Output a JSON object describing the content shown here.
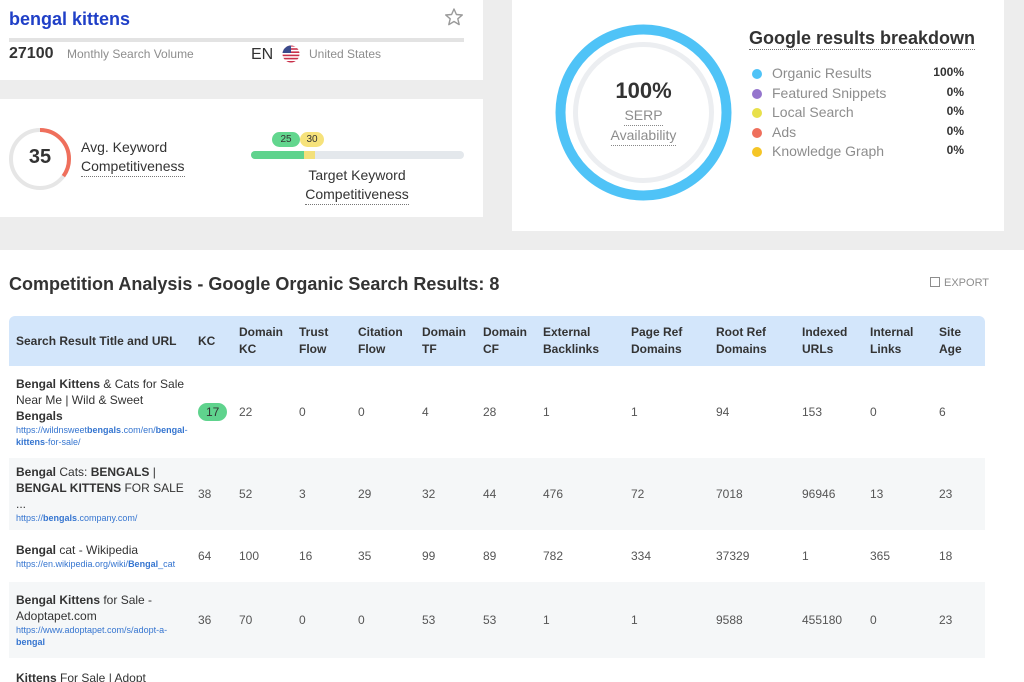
{
  "keyword": {
    "title": "bengal kittens",
    "volume": "27100",
    "volume_label": "Monthly Search Volume",
    "language": "EN",
    "country": "United States"
  },
  "competitiveness": {
    "avg_value": "35",
    "avg_fraction": 0.35,
    "avg_label_line1": "Avg. Keyword",
    "avg_label_line2": "Competitiveness",
    "target_low": "25",
    "target_high": "30",
    "target_low_fraction": 0.25,
    "target_high_fraction": 0.3,
    "target_label_line1": "Target Keyword",
    "target_label_line2": "Competitiveness"
  },
  "serp": {
    "percent": "100%",
    "label_line1": "SERP",
    "label_line2": "Availability",
    "breakdown_title": "Google results breakdown",
    "items": [
      {
        "name": "Organic Results",
        "value": "100%",
        "color": "#4fc3f7"
      },
      {
        "name": "Featured Snippets",
        "value": "0%",
        "color": "#9575cd"
      },
      {
        "name": "Local Search",
        "value": "0%",
        "color": "#e8e04a"
      },
      {
        "name": "Ads",
        "value": "0%",
        "color": "#ef6f5c"
      },
      {
        "name": "Knowledge Graph",
        "value": "0%",
        "color": "#f5c526"
      }
    ]
  },
  "analysis": {
    "title": "Competition Analysis - Google Organic Search Results: 8",
    "export_label": "EXPORT",
    "headers": [
      [
        "Search Result Title and URL"
      ],
      [
        "KC"
      ],
      [
        "Domain",
        "KC"
      ],
      [
        "Trust",
        "Flow"
      ],
      [
        "Citation",
        "Flow"
      ],
      [
        "Domain",
        "TF"
      ],
      [
        "Domain",
        "CF"
      ],
      [
        "External",
        "Backlinks"
      ],
      [
        "Page Ref",
        "Domains"
      ],
      [
        "Root Ref",
        "Domains"
      ],
      [
        "Indexed",
        "URLs"
      ],
      [
        "Internal",
        "Links"
      ],
      [
        "Site",
        "Age"
      ]
    ],
    "rows": [
      {
        "title_parts": [
          [
            "Bengal Kittens",
            true
          ],
          [
            " & Cats for Sale Near Me | Wild & Sweet ",
            false
          ],
          [
            "Bengals",
            true
          ]
        ],
        "url_parts": [
          [
            "https://wildnsweet",
            false
          ],
          [
            "bengals",
            true
          ],
          [
            ".com/en/",
            false
          ],
          [
            "bengal",
            true
          ],
          [
            "-",
            false
          ],
          [
            "kittens",
            true
          ],
          [
            "-for-sale/",
            false
          ]
        ],
        "kc": "17",
        "kc_highlight": true,
        "values": [
          "22",
          "0",
          "0",
          "4",
          "28",
          "1",
          "1",
          "94",
          "153",
          "0",
          "6"
        ]
      },
      {
        "title_parts": [
          [
            "Bengal",
            true
          ],
          [
            " Cats: ",
            false
          ],
          [
            "BENGALS",
            true
          ],
          [
            " | ",
            false
          ],
          [
            "BENGAL KITTENS",
            true
          ],
          [
            " FOR SALE ...",
            false
          ]
        ],
        "url_parts": [
          [
            "https://",
            false
          ],
          [
            "bengals",
            true
          ],
          [
            ".company.com/",
            false
          ]
        ],
        "kc": "38",
        "kc_highlight": false,
        "values": [
          "52",
          "3",
          "29",
          "32",
          "44",
          "476",
          "72",
          "7018",
          "96946",
          "13",
          "23"
        ]
      },
      {
        "title_parts": [
          [
            "Bengal",
            true
          ],
          [
            " cat - Wikipedia",
            false
          ]
        ],
        "url_parts": [
          [
            "https://en.wikipedia.org/wiki/",
            false
          ],
          [
            "Bengal",
            true
          ],
          [
            "_cat",
            false
          ]
        ],
        "kc": "64",
        "kc_highlight": false,
        "values": [
          "100",
          "16",
          "35",
          "99",
          "89",
          "782",
          "334",
          "37329",
          "1",
          "365",
          "18"
        ]
      },
      {
        "title_parts": [
          [
            "Bengal Kittens",
            true
          ],
          [
            " for Sale - Adoptapet.com",
            false
          ]
        ],
        "url_parts": [
          [
            "https://www.adoptapet.com/s/adopt-a-",
            false
          ],
          [
            "bengal",
            true
          ]
        ],
        "kc": "36",
        "kc_highlight": false,
        "values": [
          "70",
          "0",
          "0",
          "53",
          "53",
          "1",
          "1",
          "9588",
          "455180",
          "0",
          "23"
        ]
      },
      {
        "title_parts": [
          [
            "Kittens",
            true
          ],
          [
            " For Sale | Adopt",
            false
          ]
        ],
        "url_parts": [],
        "kc": "",
        "kc_highlight": false,
        "values": [
          "",
          "",
          "",
          "",
          "",
          "",
          "",
          "",
          "",
          "",
          ""
        ]
      }
    ]
  }
}
